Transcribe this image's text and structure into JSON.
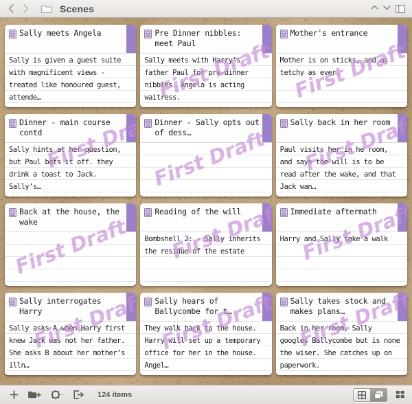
{
  "window": {
    "title": "Scenes",
    "back_icon": "chevron-left-icon",
    "forward_icon": "chevron-right-icon",
    "folder_icon": "folder-icon",
    "collapse_up_icon": "chevron-up-icon",
    "collapse_down_icon": "chevron-down-icon",
    "layout_icon": "split-view-icon"
  },
  "stamp_label": "First Draft",
  "colors": {
    "card_strip": "#9b7fc9",
    "stamp": "#c48ed4",
    "cork": "#b79c76"
  },
  "cards": [
    {
      "title": "Sally meets Angela",
      "body": "Sally is given a guest suite with magnificent views - treated like honoured guest, attende…",
      "stamped": false
    },
    {
      "title": "Pre Dinner nibbles: meet Paul",
      "body": "Sally meets with Harry’s father Paul for pre-dinner nibbles. Angela is acting waitress.",
      "stamped": true
    },
    {
      "title": "Mother's entrance",
      "body": "Mother is on sticks, and as tetchy as ever.",
      "stamped": true
    },
    {
      "title": "Dinner - main course contd",
      "body": "Sally hints at her question, but Paul bats it off. they drink a toast to Jack. Sally’s…",
      "stamped": true
    },
    {
      "title": "Dinner - Sally opts out of dess…",
      "body": "",
      "stamped": true
    },
    {
      "title": "Sally back in her room",
      "body": "Paul visits her in he room, and says the will is to be read after the wake, and that Jack wan…",
      "stamped": true
    },
    {
      "title": "Back at the house, the wake",
      "body": "",
      "stamped": true
    },
    {
      "title": "Reading of the will",
      "body": "Bombshell 2: - Sally inherits the residue of the estate",
      "stamped": true
    },
    {
      "title": "Immediate aftermath",
      "body": "Harry and Sally take a walk",
      "stamped": true
    },
    {
      "title": "Sally interrogates Harry",
      "body": "Sally asks A when Harry first knew Jack was not her father. She asks B about her mother’s illn…",
      "stamped": true
    },
    {
      "title": "Sally hears of Ballycombe for t…",
      "body": "They walk back to the house. Harry will set up a temporary office for her in the house. Angel…",
      "stamped": true
    },
    {
      "title": "Sally takes stock and makes plans…",
      "body": "Back in her room, Sally googles Ballycombe but is none the wiser. She catches up on paperwork.",
      "stamped": true
    }
  ],
  "toolbar": {
    "add_icon": "plus-icon",
    "add_folder_icon": "new-folder-icon",
    "settings_icon": "gear-icon",
    "export_icon": "export-icon",
    "item_count": "124 items",
    "view_grid_icon": "grid-view-icon",
    "view_cards_icon": "cards-view-icon",
    "layout_options_icon": "layout-options-icon"
  }
}
